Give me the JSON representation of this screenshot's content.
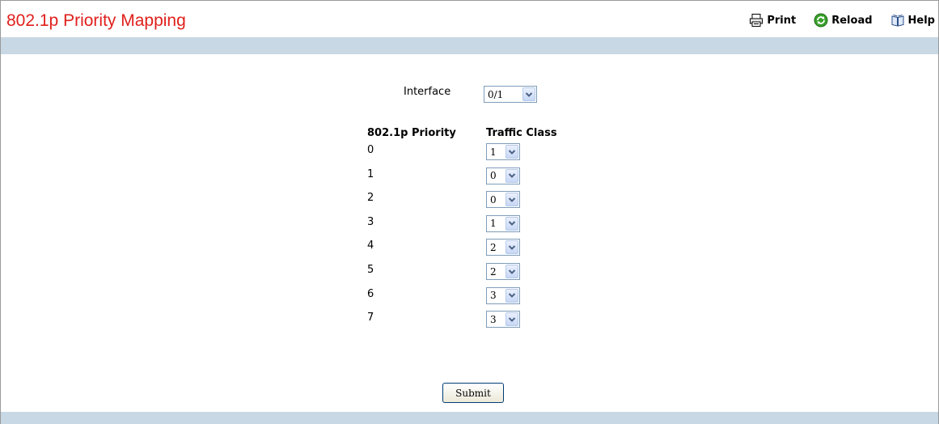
{
  "page": {
    "title": "802.1p Priority Mapping"
  },
  "toolbar": {
    "print_label": "Print",
    "reload_label": "Reload",
    "help_label": "Help"
  },
  "form": {
    "interface_label": "Interface",
    "interface_value": "0/1",
    "priority_header": "802.1p Priority",
    "class_header": "Traffic Class",
    "rows": [
      {
        "priority": "0",
        "traffic_class": "1"
      },
      {
        "priority": "1",
        "traffic_class": "0"
      },
      {
        "priority": "2",
        "traffic_class": "0"
      },
      {
        "priority": "3",
        "traffic_class": "1"
      },
      {
        "priority": "4",
        "traffic_class": "2"
      },
      {
        "priority": "5",
        "traffic_class": "2"
      },
      {
        "priority": "6",
        "traffic_class": "3"
      },
      {
        "priority": "7",
        "traffic_class": "3"
      }
    ],
    "submit_label": "Submit"
  },
  "colors": {
    "title": "#e0201c",
    "bar": "#c8d8e4"
  }
}
